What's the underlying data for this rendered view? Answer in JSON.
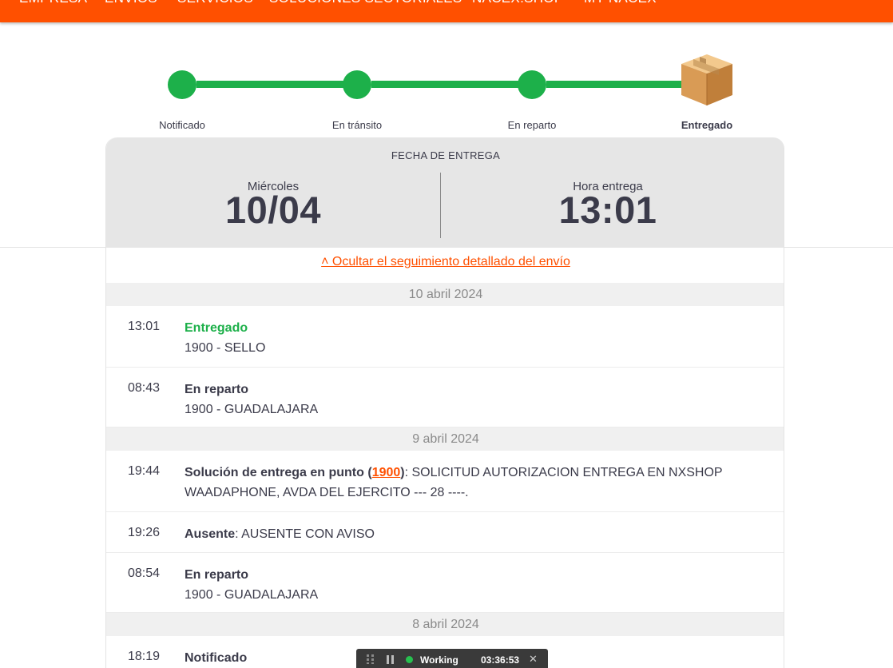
{
  "nav": {
    "items": [
      "EMPRESA",
      "ENVÍOS",
      "SERVICIOS",
      "SOLUCIONES SECTORIALES",
      "NACEX.SHOP",
      "MY NACEX"
    ]
  },
  "tracker": {
    "steps": [
      {
        "label": "Notificado",
        "state": "done"
      },
      {
        "label": "En tránsito",
        "state": "done"
      },
      {
        "label": "En reparto",
        "state": "done"
      },
      {
        "label": "Entregado",
        "state": "current"
      }
    ],
    "current_icon": "package-box-icon"
  },
  "delivery": {
    "title": "FECHA DE ENTREGA",
    "day_label": "Miércoles",
    "date": "10/04",
    "time_label": "Hora entrega",
    "time": "13:01"
  },
  "toggle_link": "˄ Ocultar el seguimiento detallado del envío",
  "history": [
    {
      "date": "10 abril 2024",
      "events": [
        {
          "time": "13:01",
          "status": "Entregado",
          "detail": "1900 - SELLO"
        },
        {
          "time": "08:43",
          "status": "En reparto",
          "detail": "1900 - GUADALAJARA"
        }
      ]
    },
    {
      "date": "9 abril 2024",
      "events": [
        {
          "time": "19:44",
          "status": "Solución de entrega en punto",
          "status_open": " (",
          "link": "1900",
          "status_close": ")",
          "after": ": SOLICITUD AUTORIZACION ENTREGA EN NXSHOP WAADAPHONE, AVDA DEL EJERCITO --- 28 ----."
        },
        {
          "time": "19:26",
          "status": "Ausente",
          "after": ": AUSENTE CON AVISO"
        },
        {
          "time": "08:54",
          "status": "En reparto",
          "detail": "1900 - GUADALAJARA"
        }
      ]
    },
    {
      "date": "8 abril 2024",
      "events": [
        {
          "time": "18:19",
          "status": "Notificado"
        }
      ]
    }
  ],
  "recorder": {
    "status": "Working",
    "timer": "03:36:53",
    "close": "✕"
  },
  "colors": {
    "brand": "#ff5000",
    "success": "#1db04a",
    "text": "#3b3b4a"
  }
}
